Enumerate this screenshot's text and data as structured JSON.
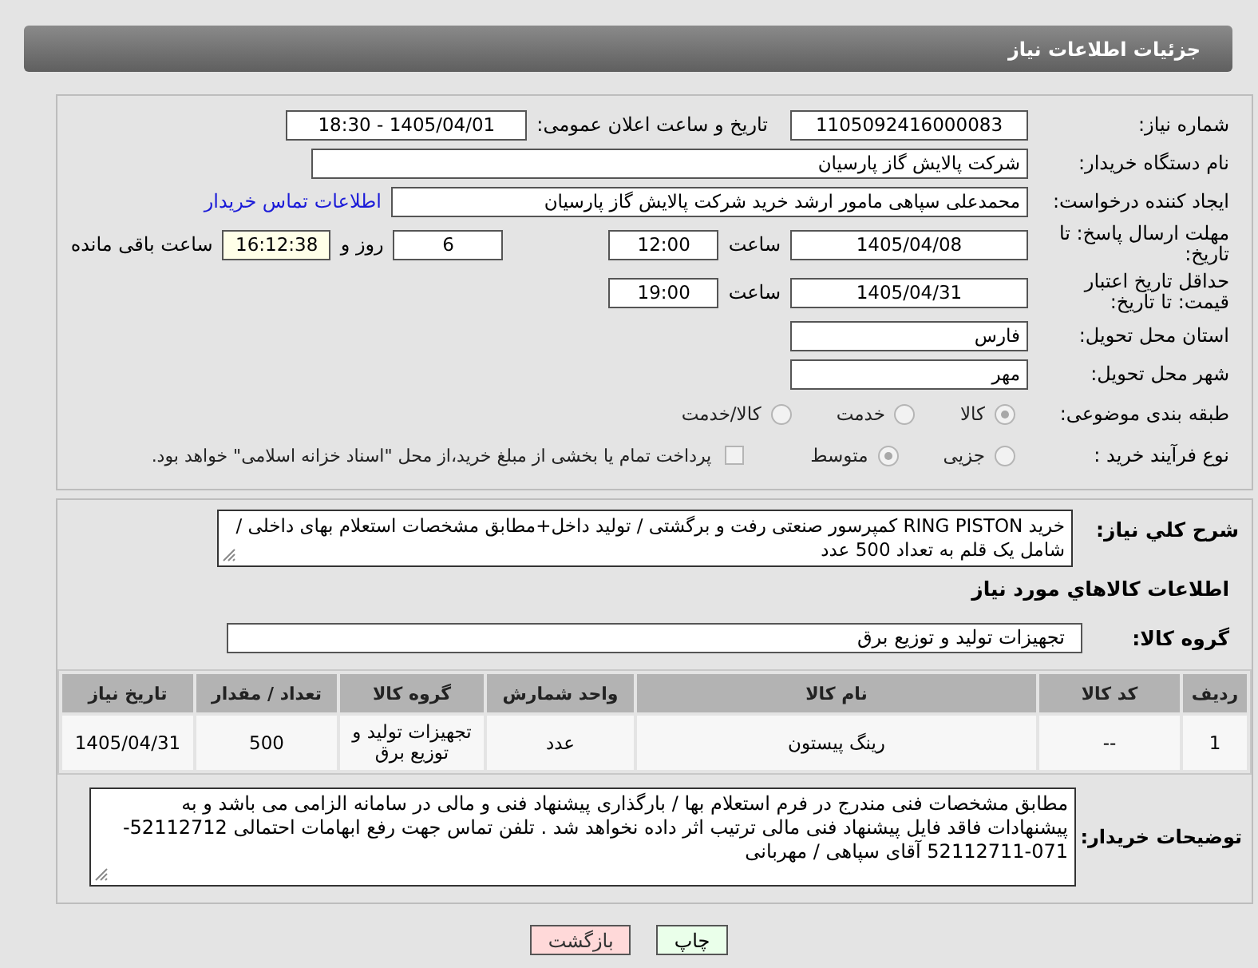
{
  "header": {
    "title": "جزئیات اطلاعات نیاز"
  },
  "need_number": {
    "label": "شماره نیاز:",
    "value": "1105092416000083"
  },
  "announce": {
    "label": "تاریخ و ساعت اعلان عمومی:",
    "value": "1405/04/01 - 18:30"
  },
  "buyer_org": {
    "label": "نام دستگاه خریدار:",
    "value": "شرکت پالایش گاز پارسیان"
  },
  "requester": {
    "label": "ایجاد کننده درخواست:",
    "value": "محمدعلی سپاهی مامور ارشد خرید شرکت پالایش گاز پارسیان",
    "link": "اطلاعات تماس خریدار"
  },
  "reply_deadline": {
    "label": "مهلت ارسال پاسخ: تا تاریخ:",
    "date": "1405/04/08",
    "time_label": "ساعت",
    "time": "12:00",
    "days": "6",
    "days_label": "روز و",
    "remaining": "16:12:38",
    "remaining_label": "ساعت باقی مانده"
  },
  "price_validity": {
    "label": "حداقل تاریخ اعتبار قیمت: تا تاریخ:",
    "date": "1405/04/31",
    "time_label": "ساعت",
    "time": "19:00"
  },
  "province": {
    "label": "استان محل تحویل:",
    "value": "فارس"
  },
  "city": {
    "label": "شهر محل تحویل:",
    "value": "مهر"
  },
  "category": {
    "label": "طبقه بندی موضوعی:",
    "options": [
      {
        "label": "کالا",
        "selected": true
      },
      {
        "label": "خدمت",
        "selected": false
      },
      {
        "label": "کالا/خدمت",
        "selected": false
      }
    ]
  },
  "process": {
    "label": "نوع فرآیند خرید :",
    "options": [
      {
        "label": "جزیی",
        "selected": false
      },
      {
        "label": "متوسط",
        "selected": true
      }
    ],
    "payment": {
      "checked": false,
      "text": "پرداخت تمام یا بخشی از مبلغ خرید،از محل \"اسناد خزانه اسلامی\" خواهد بود."
    }
  },
  "description": {
    "label": "شرح كلي نياز:",
    "value": "خرید RING PISTON کمپرسور صنعتی رفت و برگشتی / تولید داخل+مطابق مشخصات استعلام بهای داخلی / شامل یک قلم به تعداد 500 عدد"
  },
  "items_title": "اطلاعات كالاهاي مورد نياز",
  "goods_group": {
    "label": "گروه کالا:",
    "value": "تجهیزات تولید و توزیع برق"
  },
  "table": {
    "columns": [
      "ردیف",
      "کد کالا",
      "نام کالا",
      "واحد شمارش",
      "گروه کالا",
      "تعداد / مقدار",
      "تاریخ نیاز"
    ],
    "rows": [
      [
        "1",
        "--",
        "رینگ پیستون",
        "عدد",
        "تجهیزات تولید و توزیع برق",
        "500",
        "1405/04/31"
      ]
    ]
  },
  "buyer_notes": {
    "label": "توضیحات خریدار:",
    "value": "مطابق مشخصات فنی مندرج در فرم استعلام بها / بارگذاری پیشنهاد فنی و مالی در سامانه الزامی می باشد و به پیشنهادات فاقد فایل پیشنهاد فنی مالی ترتیب اثر داده نخواهد شد . تلفن تماس جهت رفع ابهامات احتمالی 52112712-071-52112711 آقای سپاهی / مهربانی"
  },
  "buttons": [
    {
      "label": "چاپ",
      "kind": "print"
    },
    {
      "label": "بازگشت",
      "kind": "back"
    }
  ]
}
